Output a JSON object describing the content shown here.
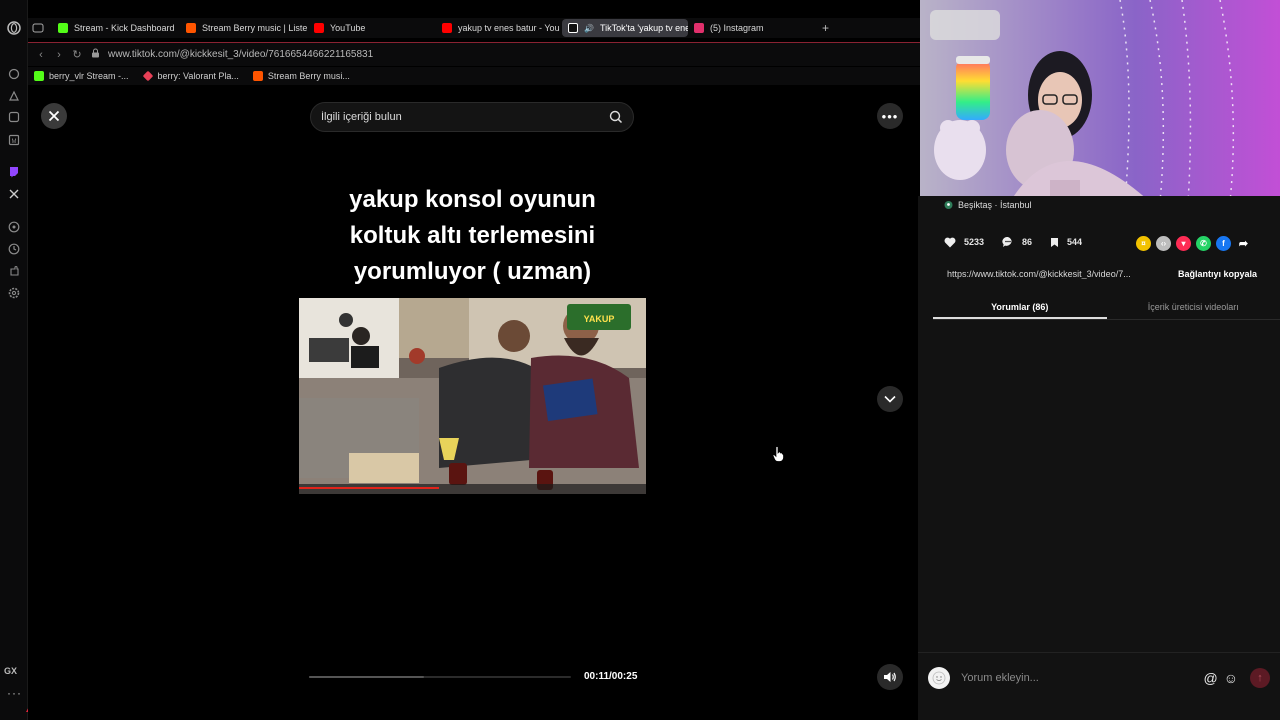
{
  "browser": {
    "tabs": [
      {
        "label": "Stream - Kick Dashboard",
        "icon": "kick-icon",
        "color": "#53fc18"
      },
      {
        "label": "Stream Berry music | Liste",
        "icon": "soundcloud-icon",
        "color": "#ff5500"
      },
      {
        "label": "YouTube",
        "icon": "youtube-icon",
        "color": "#ff0000"
      },
      {
        "label": "yakup tv enes batur - You",
        "icon": "youtube-icon",
        "color": "#ff0000"
      },
      {
        "label": "TikTok'ta 'yakup tv ene",
        "icon": "tiktok-icon",
        "color": "#ffffff"
      },
      {
        "label": "(5) Instagram",
        "icon": "instagram-icon",
        "color": "#e1306c"
      }
    ],
    "url": "www.tiktok.com/@kickkesit_3/video/7616654466221165831",
    "bookmarks": [
      {
        "label": "berry_vlr Stream -...",
        "icon": "kick-icon",
        "color": "#53fc18"
      },
      {
        "label": "berry: Valorant Pla...",
        "icon": "tracker-icon",
        "color": "#e84057"
      },
      {
        "label": "Stream Berry musi...",
        "icon": "soundcloud-icon",
        "color": "#ff5500"
      }
    ],
    "rail": {
      "gx_label": "GX",
      "accent": "#e4243b"
    }
  },
  "video": {
    "search_placeholder": "İlgili içeriği bulun",
    "caption_lines": [
      "yakup konsol oyunun",
      "koltuk altı terlemesini",
      "yorumluyor ( uzman)"
    ],
    "timecode": "00:11/00:25",
    "progress": 0.44
  },
  "panel": {
    "location": "Beşiktaş · İstanbul",
    "likes": "5233",
    "comments": "86",
    "saves": "544",
    "link": "https://www.tiktok.com/@kickkesit_3/video/7...",
    "copy_label": "Bağlantıyı kopyala",
    "tabs": [
      "Yorumlar (86)",
      "İçerik üreticisi videoları"
    ],
    "comment_placeholder": "Yorum ekleyin...",
    "accent": "#fe2c55"
  }
}
